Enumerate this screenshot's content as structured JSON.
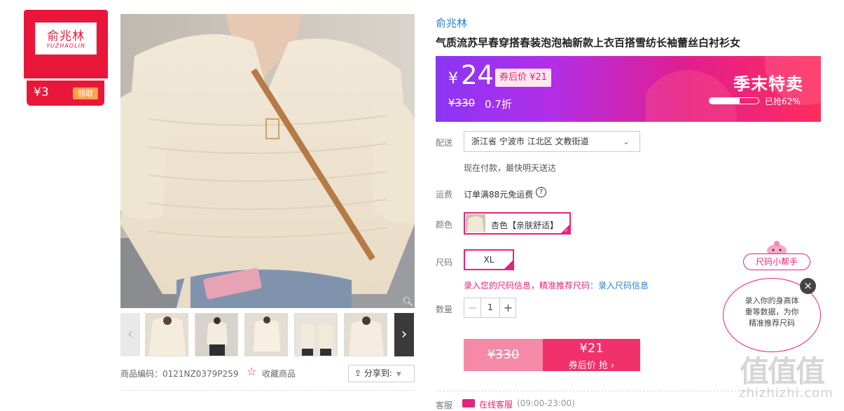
{
  "shop": {
    "logo_cn": "俞兆林",
    "logo_en": "YUZHAOLIN",
    "coupon_amount": "¥3",
    "coupon_take_label": "领取"
  },
  "gallery": {
    "prev_arrow": "‹",
    "next_arrow": "›",
    "zoom_icon": "search-icon",
    "thumbnail_count": 5
  },
  "meta": {
    "product_code": "商品编码：0121NZ0379P259",
    "favorite_label": "收藏商品",
    "share_label": "分享到:"
  },
  "product": {
    "brand": "俞兆林",
    "title": "气质流苏早春穿搭春装泡泡袖新款上衣百搭雪纺长袖蕾丝白衬衫女"
  },
  "price": {
    "currency": "¥",
    "now": "24",
    "after_coupon": "券后价 ¥21",
    "original": "¥330",
    "discount": "0.7折",
    "promo_title": "季末特卖",
    "sold_text": "已抢62%",
    "sold_fraction": 0.62
  },
  "delivery": {
    "label": "配送",
    "address": "浙江省 宁波市 江北区 文教街道",
    "note": "现在付款，最快明天送达"
  },
  "shipping": {
    "label": "运费",
    "text": "订单满88元免运费",
    "help_icon": "?"
  },
  "color": {
    "label": "颜色",
    "option": "杏色【亲肤舒适】"
  },
  "size": {
    "label": "尺码",
    "option": "XL",
    "hint": "录入您的尺码信息，精准推荐尺码：",
    "link": "录入尺码信息"
  },
  "quantity": {
    "label": "数量",
    "minus": "−",
    "value": "1",
    "plus": "+"
  },
  "buy": {
    "original_price": "¥330",
    "coupon_price": "¥21",
    "coupon_label": "券后价 抢 ›"
  },
  "service": {
    "label": "客服",
    "text": "在线客服",
    "hours": "(09:00-23:00)"
  },
  "size_helper": {
    "tag": "尺码小帮手",
    "line1": "录入你的身高体",
    "line2": "重等数据，为你",
    "line3": "精准推荐尺码",
    "close": "×"
  },
  "watermark": {
    "logo": "值值值",
    "text": "zhizhizhi.com"
  },
  "colors": {
    "accent": "#e4237b",
    "shop_red": "#e8173a",
    "link_blue": "#2b7fd0"
  }
}
